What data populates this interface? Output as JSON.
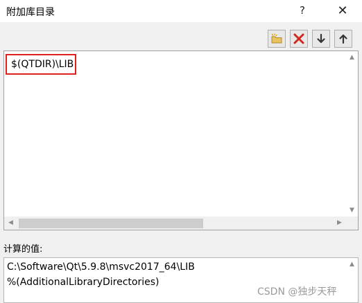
{
  "window": {
    "title": "附加库目录",
    "help_label": "?",
    "close_label": "✕"
  },
  "toolbar": {
    "buttons": [
      {
        "name": "new-line",
        "icon": "new-folder-icon"
      },
      {
        "name": "delete",
        "icon": "delete-x-icon"
      },
      {
        "name": "move-down",
        "icon": "arrow-down-icon"
      },
      {
        "name": "move-up",
        "icon": "arrow-up-icon"
      }
    ]
  },
  "editor": {
    "entries": [
      "$(QTDIR)\\LIB"
    ],
    "highlight_color": "#e0201c"
  },
  "computed": {
    "label": "计算的值:",
    "lines": [
      "C:\\Software\\Qt\\5.9.8\\msvc2017_64\\LIB",
      "%(AdditionalLibraryDirectories)"
    ]
  },
  "watermark": "CSDN @独步天秤"
}
